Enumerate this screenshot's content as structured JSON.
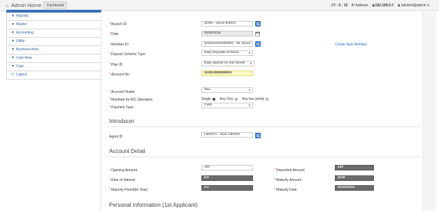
{
  "header": {
    "brand": "Admin Home",
    "dashboard_tab": "Dashboard",
    "clock": "7 : 5 : 13",
    "ip_label": "IP Address",
    "ip_value": "192.168.0.7",
    "user": "lakshmi@admin"
  },
  "sidebar": {
    "items": [
      {
        "label": "Reports"
      },
      {
        "label": "Master"
      },
      {
        "label": "Accounting"
      },
      {
        "label": "Utility"
      },
      {
        "label": "Business Area"
      },
      {
        "label": "Loan Area"
      },
      {
        "label": "Logs"
      },
      {
        "label": "Logout"
      }
    ]
  },
  "form": {
    "branch_id_label": "Branch ID",
    "branch_id_value": "11001 - tanuir branch",
    "date_label": "Date",
    "date_value": "02/09/2016",
    "member_id_label": "Member ID",
    "member_id_value": "1100110010000001 - Mr. tanuir",
    "create_member_link": "Create New Member",
    "deposit_type_label": "Deposit Scheme Type",
    "deposit_type_value": "Daily Deposite Scheme",
    "plan_id_label": "Plan ID",
    "plan_id_value": "Daily deposit for one Month",
    "account_no_label": "Account No.",
    "account_no_value": "110012020000001",
    "account_holder_label": "Account Holder",
    "account_holder_value": "Two",
    "mandate_label": "Mandate for A/C Operation",
    "mandate_single": "Single",
    "mandate_any_one": "Any One",
    "mandate_any_two": "Any two jointly",
    "payment_type_label": "Payment Type",
    "payment_type_value": "Cash"
  },
  "introducer": {
    "title": "Introducer",
    "agent_id_label": "Agent ID",
    "agent_id_value": "Lakshmi -  Jaya  Lakshmi"
  },
  "account_detail": {
    "title": "Account Detail",
    "opening_amount_label": "Opening Amount",
    "opening_amount_value": "100",
    "deposited_amount_label": "Deposited Amount",
    "deposited_amount_value": "100",
    "rate_label": "Rate of Interest",
    "rate_value": "6.9",
    "maturity_amount_label": "Maturity Amount",
    "maturity_amount_value": "3118",
    "maturity_period_label": "Maturity Period(In Year)",
    "maturity_period_value": "0.1",
    "maturity_date_label": "Maturity Date",
    "maturity_date_value": "02/10/2016"
  },
  "personal": {
    "title": "Personal Information (1st Applicant)"
  },
  "colors": {
    "accent": "#3b78c2",
    "required": "#d9534f"
  }
}
